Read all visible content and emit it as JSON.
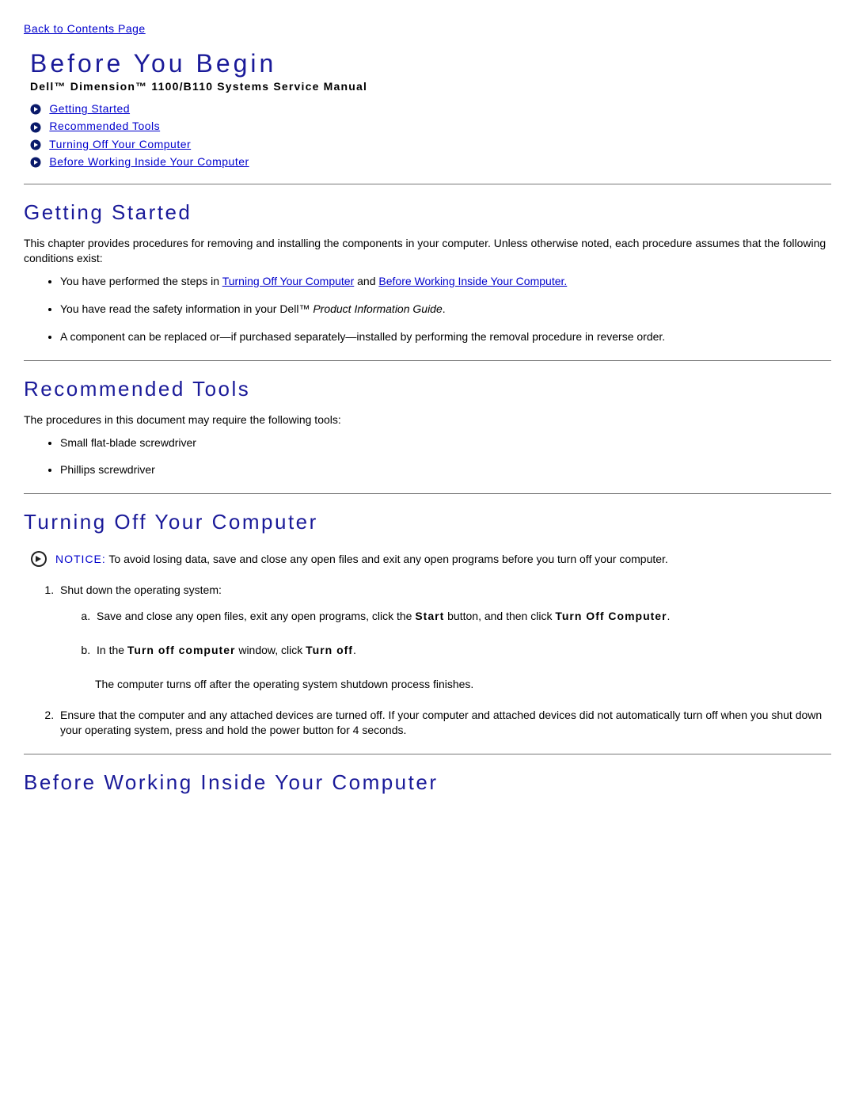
{
  "backLink": "Back to Contents Page",
  "pageTitle": "Before You Begin",
  "subtitle": "Dell™ Dimension™ 1100/B110 Systems Service Manual",
  "toc": [
    "Getting Started",
    "Recommended Tools",
    "Turning Off Your Computer",
    "Before Working Inside Your Computer"
  ],
  "sections": {
    "gettingStarted": {
      "heading": "Getting Started",
      "intro": "This chapter provides procedures for removing and installing the components in your computer. Unless otherwise noted, each procedure assumes that the following conditions exist:",
      "items": {
        "i0_pre": "You have performed the steps in ",
        "i0_link1": "Turning Off Your Computer",
        "i0_mid": " and ",
        "i0_link2": "Before Working Inside Your Computer.",
        "i1_pre": "You have read the safety information in your Dell™ ",
        "i1_italic": "Product Information Guide",
        "i1_post": ".",
        "i2": "A component can be replaced or—if purchased separately—installed by performing the removal procedure in reverse order."
      }
    },
    "recommendedTools": {
      "heading": "Recommended Tools",
      "intro": "The procedures in this document may require the following tools:",
      "tools": [
        "Small flat-blade screwdriver",
        "Phillips screwdriver"
      ]
    },
    "turningOff": {
      "heading": "Turning Off Your Computer",
      "noticeLabel": "NOTICE:",
      "noticeText": " To avoid losing data, save and close any open files and exit any open programs before you turn off your computer.",
      "step1": "Shut down the operating system:",
      "step1a_pre": "Save and close any open files, exit any open programs, click the ",
      "step1a_b1": "Start",
      "step1a_mid": " button, and then click ",
      "step1a_b2": "Turn Off Computer",
      "step1a_post": ".",
      "step1b_pre": "In the ",
      "step1b_b1": "Turn off computer",
      "step1b_mid": " window, click ",
      "step1b_b2": "Turn off",
      "step1b_post": ".",
      "step1_after": "The computer turns off after the operating system shutdown process finishes.",
      "step2": "Ensure that the computer and any attached devices are turned off. If your computer and attached devices did not automatically turn off when you shut down your operating system, press and hold the power button for 4 seconds."
    },
    "beforeWorking": {
      "heading": "Before Working Inside Your Computer"
    }
  }
}
